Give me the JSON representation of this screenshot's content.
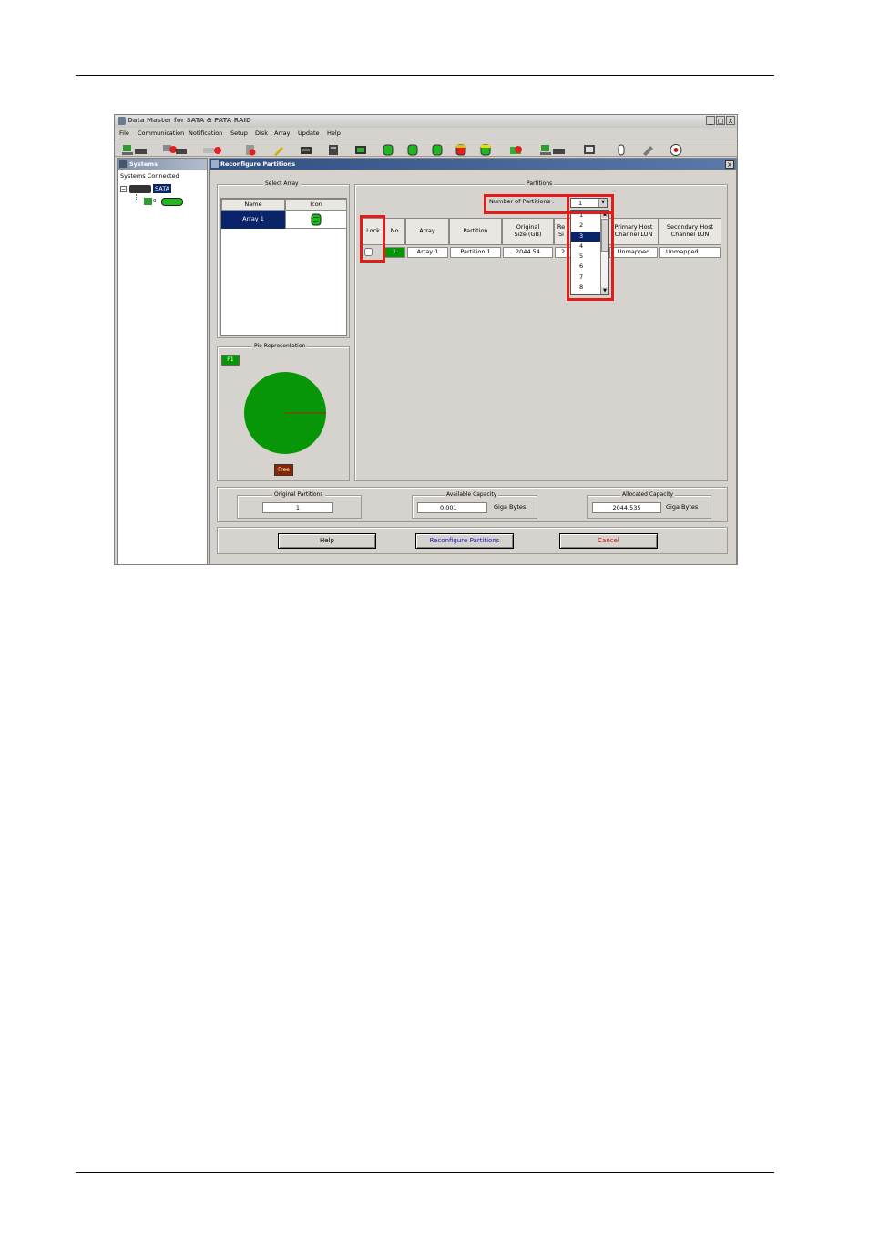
{
  "app": {
    "title": "Data Master for SATA & PATA RAID",
    "window_controls": [
      "_",
      "□",
      "X"
    ],
    "menu": [
      "File",
      "Communication",
      "Notification",
      "Setup",
      "Disk",
      "Array",
      "Update",
      "Help"
    ]
  },
  "sidebar": {
    "title": "Systems",
    "root_label": "Systems Connected",
    "system_label": "SATA",
    "child_label": "0"
  },
  "dialog": {
    "title": "Reconfigure Partitions",
    "close": "X",
    "select_array": {
      "legend": "Select Array",
      "columns": [
        "Name",
        "Icon"
      ],
      "rows": [
        {
          "name": "Array 1"
        }
      ]
    },
    "pie": {
      "legend": "Pie Representation",
      "partition_label": "P1",
      "free_label": "Free",
      "partition_color": "#079607",
      "free_color": "#8b2500"
    },
    "partitions": {
      "legend": "Partitions",
      "count_label": "Number of Partitions  :",
      "count_value": "1",
      "count_options": [
        "1",
        "2",
        "3",
        "4",
        "5",
        "6",
        "7",
        "8"
      ],
      "count_highlighted": "3",
      "columns": [
        "Lock",
        "No",
        "Array",
        "Partition",
        "Original Size (GB)",
        "Re Si",
        "Primary Host Channel LUN",
        "Secondary Host Channel LUN"
      ],
      "rows": [
        {
          "lock": false,
          "no": "1",
          "array": "Array 1",
          "partition": "Partition 1",
          "original_size": "2044.54",
          "resized": "2",
          "primary": "Unmapped",
          "secondary": "Unmapped"
        }
      ]
    },
    "original_partitions": {
      "legend": "Original Partitions",
      "value": "1"
    },
    "available_capacity": {
      "legend": "Available Capacity",
      "value": "0.001",
      "unit": "Giga Bytes"
    },
    "allocated_capacity": {
      "legend": "Allocated Capacity",
      "value": "2044.535",
      "unit": "Giga Bytes"
    },
    "buttons": {
      "help": "Help",
      "reconfigure": "Reconfigure Partitions",
      "cancel": "Cancel"
    }
  },
  "colors": {
    "highlight_red": "#e21b1b",
    "selection_blue": "#0a246a",
    "drive_green": "#1fb81f"
  }
}
